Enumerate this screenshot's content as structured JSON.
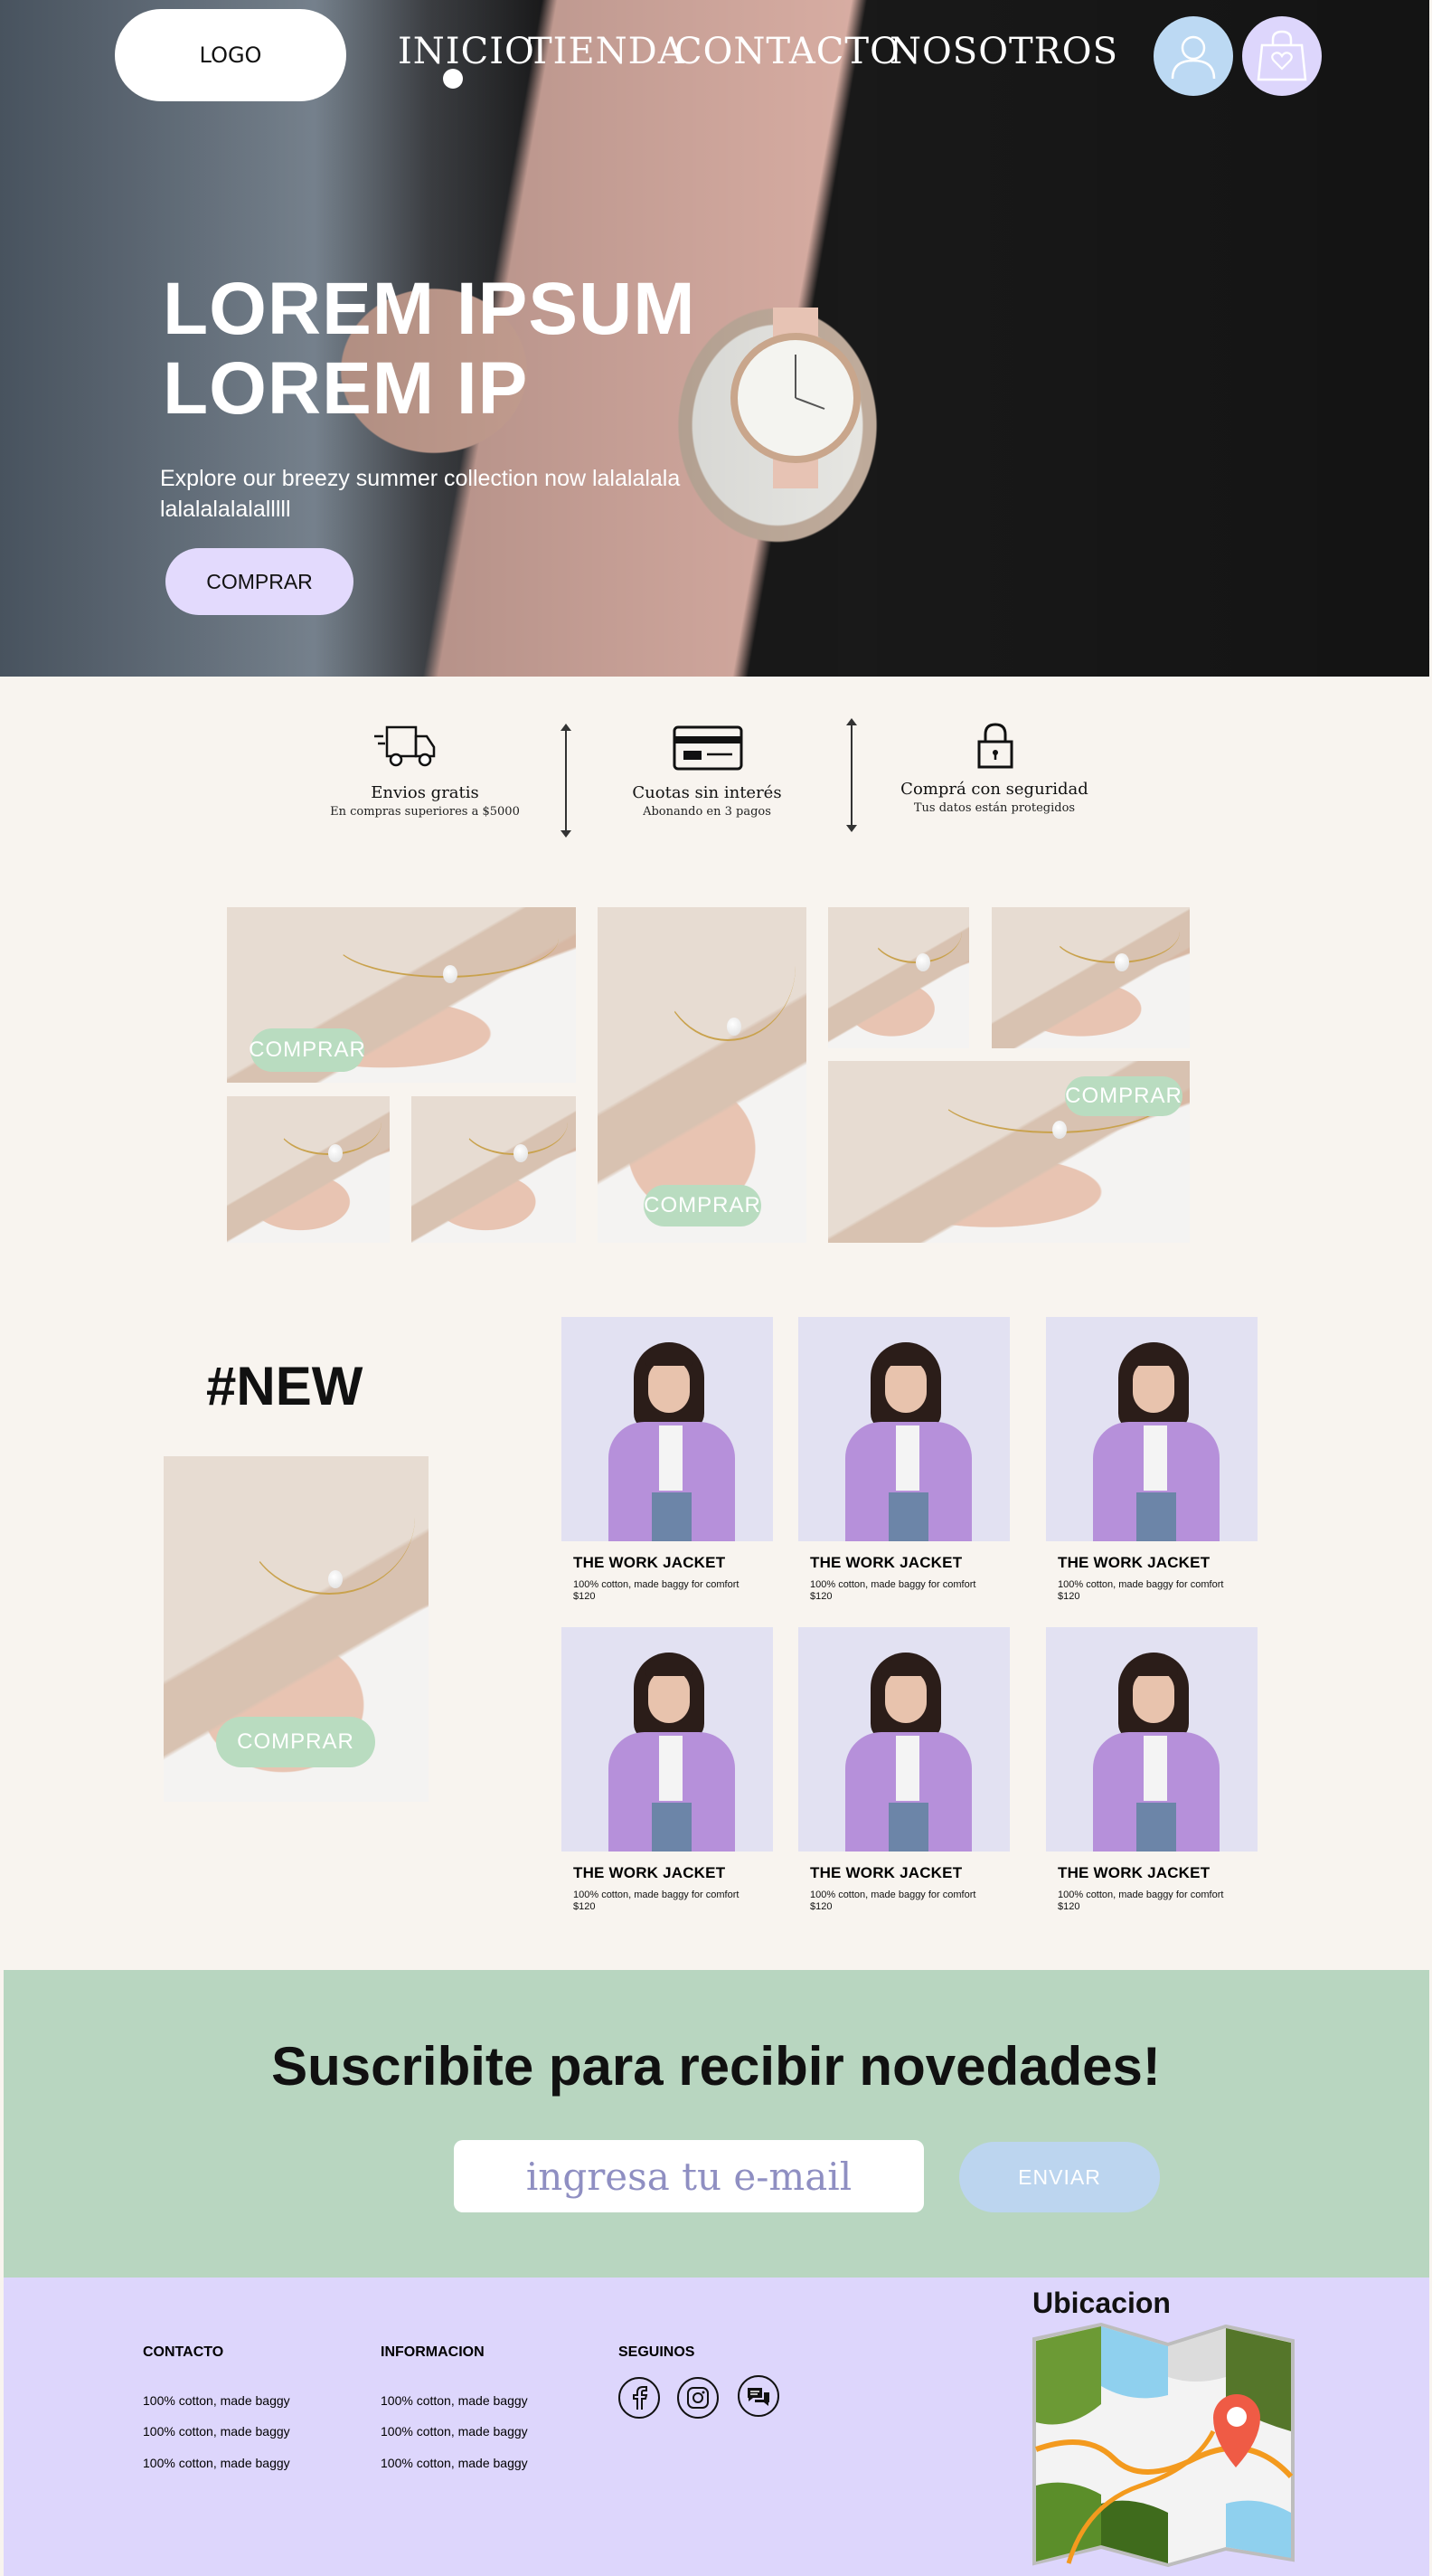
{
  "header": {
    "logo": "LOGO",
    "nav": [
      "INICIO",
      "TIENDA",
      "CONTACTO",
      "NOSOTROS"
    ],
    "user_icon": "user-icon",
    "cart_icon": "shopping-bag-heart-icon"
  },
  "hero": {
    "title_line1": "LOREM IPSUM",
    "title_line2": "LOREM IP",
    "subtitle_line1": "Explore our breezy summer collection now lalalalala",
    "subtitle_line2": "lalalalalalalllll",
    "cta": "COMPRAR"
  },
  "benefits": [
    {
      "title": "Envios gratis",
      "subtitle": "En compras superiores a $5000",
      "icon": "truck-icon"
    },
    {
      "title": "Cuotas sin interés",
      "subtitle": "Abonando en 3 pagos",
      "icon": "credit-card-icon"
    },
    {
      "title": "Comprá con seguridad",
      "subtitle": "Tus datos están protegidos",
      "icon": "lock-icon"
    }
  ],
  "gallery": {
    "cta_1": "COMPRAR",
    "cta_2": "COMPRAR",
    "cta_3": "COMPRAR"
  },
  "new_section": {
    "title": "#NEW",
    "cta": "COMPRAR"
  },
  "products": [
    {
      "name": "THE WORK JACKET",
      "desc": "100% cotton, made baggy for comfort",
      "price": "$120"
    },
    {
      "name": "THE WORK JACKET",
      "desc": "100% cotton, made baggy for comfort",
      "price": "$120"
    },
    {
      "name": "THE WORK JACKET",
      "desc": "100% cotton, made baggy for comfort",
      "price": "$120"
    },
    {
      "name": "THE WORK JACKET",
      "desc": "100% cotton, made baggy for comfort",
      "price": "$120"
    },
    {
      "name": "THE WORK JACKET",
      "desc": "100% cotton, made baggy for comfort",
      "price": "$120"
    },
    {
      "name": "THE WORK JACKET",
      "desc": "100% cotton, made baggy for comfort",
      "price": "$120"
    }
  ],
  "subscribe": {
    "title": "Suscribite para recibir novedades!",
    "placeholder": "ingresa tu e-mail",
    "button": "ENVIAR"
  },
  "footer": {
    "contacto": {
      "heading": "CONTACTO",
      "items": [
        "100% cotton, made baggy",
        "100% cotton, made baggy",
        "100% cotton, made baggy"
      ]
    },
    "informacion": {
      "heading": "INFORMACION",
      "items": [
        "100% cotton, made baggy",
        "100% cotton, made baggy",
        "100% cotton, made baggy"
      ]
    },
    "seguinos": {
      "heading": "SEGUINOS",
      "icons": [
        "facebook-icon",
        "instagram-icon",
        "chat-icon"
      ]
    },
    "ubicacion": {
      "heading": "Ubicacion",
      "icon": "map-icon"
    }
  },
  "colors": {
    "cream": "#f8f4ef",
    "lavender": "#ddd6fc",
    "mint": "#b8d6c0",
    "sky": "#bcd5ef",
    "pill_lavender": "#e3dafd"
  }
}
